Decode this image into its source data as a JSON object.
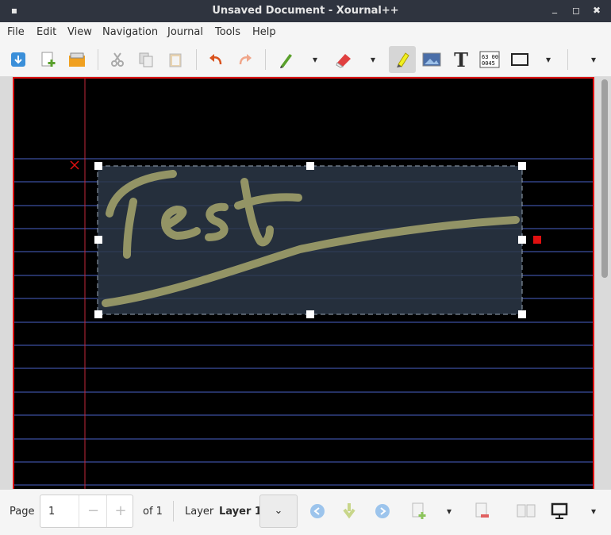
{
  "window": {
    "title": "Unsaved Document - Xournal++",
    "minimize": "▪",
    "maximize": "■",
    "close": "✖"
  },
  "menu": [
    "File",
    "Edit",
    "View",
    "Navigation",
    "Journal",
    "Tools",
    "Help"
  ],
  "toolbar": {
    "icons": [
      "save-icon",
      "new-page-icon",
      "open-folder-icon",
      "cut-icon",
      "copy-icon",
      "paste-icon",
      "undo-icon",
      "redo-icon",
      "pen-icon",
      "eraser-icon",
      "highlighter-icon",
      "image-icon",
      "text-icon",
      "latex-icon",
      "rectangle-icon"
    ],
    "active_tool": "highlighter",
    "dropdown_glyph": "▾"
  },
  "page": {
    "background": "#000000",
    "rule_color": "#4a62c9",
    "margin_color": "#c5293a",
    "handwriting_text": "Test",
    "stroke_color": "#9f9f6a"
  },
  "status": {
    "page_label": "Page",
    "page_value": "1",
    "minus": "−",
    "plus": "+",
    "of_label": "of 1",
    "layer_label": "Layer",
    "layer_value": "Layer 1",
    "layer_chevron": "⌄"
  },
  "colors": {
    "accent": "#2f343f",
    "selection_fill": "#2c3746"
  }
}
